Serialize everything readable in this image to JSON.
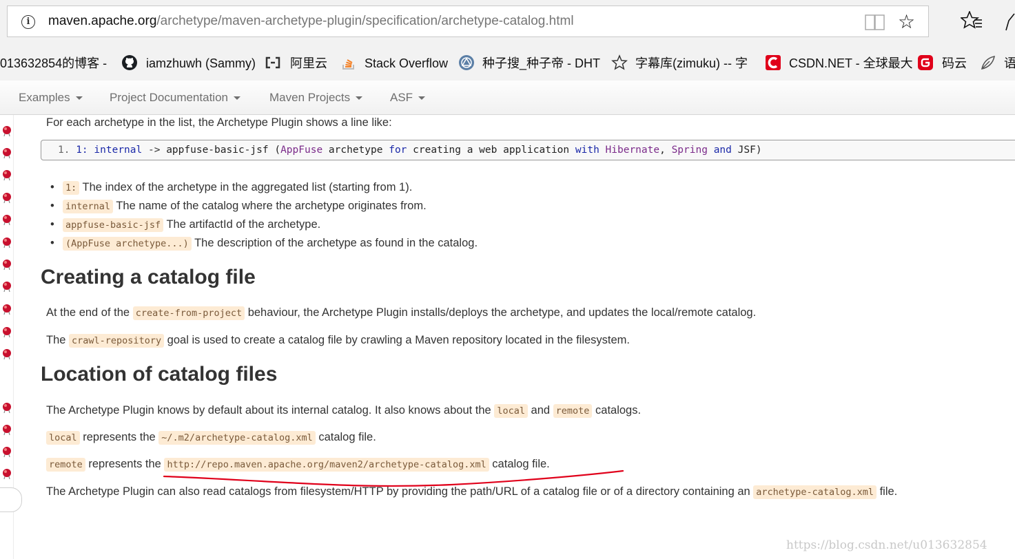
{
  "browser": {
    "url_host": "maven.apache.org",
    "url_path": "/archetype/maven-archetype-plugin/specification/archetype-catalog.html"
  },
  "bookmarks": [
    {
      "label": "013632854的博客 -",
      "icon": "none"
    },
    {
      "label": "iamzhuwh (Sammy)",
      "icon": "github-icon"
    },
    {
      "label": "阿里云",
      "icon": "aliyun-icon"
    },
    {
      "label": "Stack Overflow",
      "icon": "stackoverflow-icon"
    },
    {
      "label": "种子搜_种子帝 - DHT",
      "icon": "torrent-icon"
    },
    {
      "label": "字幕库(zimuku) -- 字",
      "icon": "star-outline-icon"
    },
    {
      "label": "CSDN.NET - 全球最大",
      "icon": "csdn-icon"
    },
    {
      "label": "码云",
      "icon": "gitee-icon"
    },
    {
      "label": "语",
      "icon": "leaf-icon"
    }
  ],
  "site_nav": [
    {
      "label": "Examples"
    },
    {
      "label": "Project Documentation"
    },
    {
      "label": "Maven Projects"
    },
    {
      "label": "ASF"
    }
  ],
  "content": {
    "intro": "For each archetype in the list, the Archetype Plugin shows a line like:",
    "code_line": {
      "num": "1.",
      "t1": "1:",
      "t2": "internal",
      "t3": "->",
      "t4": "appfuse-basic-jsf (",
      "t5": "AppFuse",
      "t6": "archetype",
      "t7": "for",
      "t8": "creating a web application",
      "t9": "with",
      "t10": "Hibernate",
      "t11": ",",
      "t12": "Spring",
      "t13": "and",
      "t14": "JSF)"
    },
    "bullets": [
      {
        "code": "1:",
        "text": " The index of the archetype in the aggregated list (starting from 1)."
      },
      {
        "code": "internal",
        "text": " The name of the catalog where the archetype originates from."
      },
      {
        "code": "appfuse-basic-jsf",
        "text": " The artifactId of the archetype."
      },
      {
        "code": "(AppFuse archetype...)",
        "text": " The description of the archetype as found in the catalog."
      }
    ],
    "h_creating": "Creating a catalog file",
    "p_create": {
      "a": "At the end of the ",
      "code": "create-from-project",
      "b": " behaviour, the Archetype Plugin installs/deploys the archetype, and updates the local/remote catalog."
    },
    "p_crawl": {
      "a": "The ",
      "code": "crawl-repository",
      "b": " goal is used to create a catalog file by crawling a Maven repository located in the filesystem."
    },
    "h_location": "Location of catalog files",
    "p_knows": {
      "a": "The Archetype Plugin knows by default about its internal catalog. It also knows about the ",
      "code1": "local",
      "b": " and ",
      "code2": "remote",
      "c": " catalogs."
    },
    "p_local": {
      "code1": "local",
      "a": " represents the ",
      "code2": "~/.m2/archetype-catalog.xml",
      "b": " catalog file."
    },
    "p_remote": {
      "code1": "remote",
      "a": " represents the ",
      "code2": "http://repo.maven.apache.org/maven2/archetype-catalog.xml",
      "b": " catalog file."
    },
    "p_read": {
      "a": "The Archetype Plugin can also read catalogs from filesystem/HTTP by providing the path/URL of a catalog file or of a directory containing an ",
      "code": "archetype-catalog.xml",
      "b": " file."
    }
  },
  "watermark": "https://blog.csdn.net/u013632854",
  "colors": {
    "annotation_red": "#e0001a",
    "code_bg": "#fdebd4"
  }
}
